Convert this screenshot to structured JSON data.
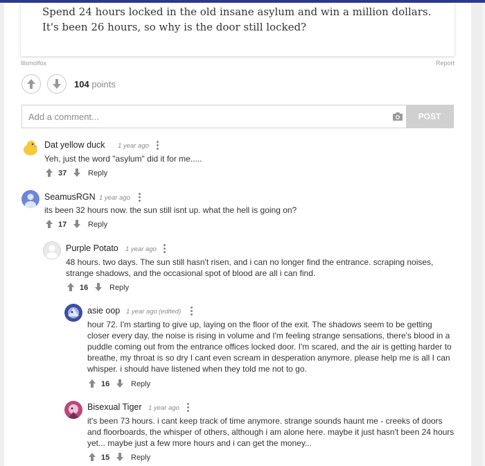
{
  "post": {
    "text": "Spend 24 hours locked in the old insane asylum and win a million dollars. It's been 26 hours, so why is the door still locked?",
    "author": "lilsmolfox",
    "report_label": "Report",
    "points_value": "104",
    "points_label": "points"
  },
  "comment_box": {
    "placeholder": "Add a comment...",
    "post_label": "POST"
  },
  "comments": [
    {
      "name": "Dat yellow duck",
      "time": "1 year ago",
      "edited": "",
      "text": "Yeh, just the word \"asylum\" did it for me.....",
      "votes": "37",
      "reply": "Reply"
    },
    {
      "name": "SeamusRGN",
      "time": "1 year ago",
      "edited": "",
      "text": "its been 32 hours now. the sun still isnt up. what the hell is going on?",
      "votes": "17",
      "reply": "Reply"
    },
    {
      "name": "Purple Potato",
      "time": "1 year ago",
      "edited": "",
      "text": "48 hours. two days. The sun still hasn't risen, and i can no longer find the entrance. scraping noises, strange shadows, and the occasional spot of blood are all i can find.",
      "votes": "16",
      "reply": "Reply"
    },
    {
      "name": "asie oop",
      "time": "1 year ago",
      "edited": "(edited)",
      "text": "hour 72. I'm starting to give up, laying on the floor of the exit. The shadows seem to be getting closer every day, the noise is rising in volume and I'm feeling strange sensations, there's blood in a puddle coming out from the entrance offices locked door. I'm scared, and the air is getting harder to breathe, my throat is so dry I cant even scream in desperation anymore. please help me is all I can whisper. i should have listened when they told me not to go.",
      "votes": "16",
      "reply": "Reply"
    },
    {
      "name": "Bisexual Tiger",
      "time": "1 year ago",
      "edited": "",
      "text": "it's been 73 hours. i cant keep track of time anymore. strange sounds haunt me - creeks of doors and floorboards, the whisper of others, although i am alone here. maybe it just hasn't been 24 hours yet... maybe just a few more hours and i can get the money...",
      "votes": "15",
      "reply": "Reply"
    }
  ],
  "colors": {
    "accent": "#2b3a8f",
    "post_button": "#d0d0d0"
  },
  "icons": [
    "upvote-icon",
    "downvote-icon",
    "camera-icon",
    "more-options-icon"
  ]
}
